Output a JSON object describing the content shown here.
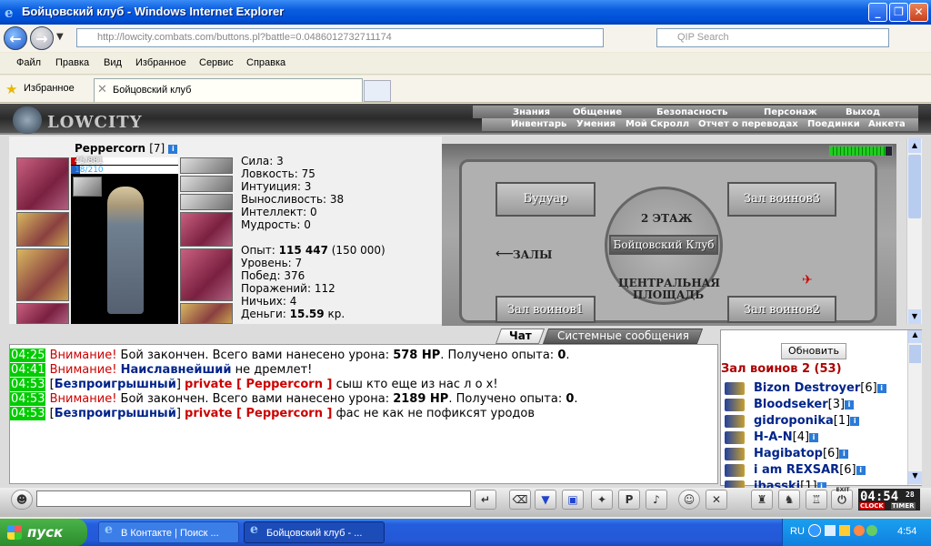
{
  "window": {
    "title": "Бойцовский клуб - Windows Internet Explorer"
  },
  "browser": {
    "url": "http://lowcity.combats.com/buttons.pl?battle=0.0486012732711174",
    "search_placeholder": "QIP Search",
    "menu": [
      "Файл",
      "Правка",
      "Вид",
      "Избранное",
      "Сервис",
      "Справка"
    ],
    "favorites_label": "Избранное",
    "tab_title": "Бойцовский клуб"
  },
  "game": {
    "logo": "LOWCITY",
    "menu_top": [
      "Знания",
      "Общение",
      "Безопасность",
      "Персонаж",
      "Выход"
    ],
    "menu_bottom": [
      "Инвентарь",
      "Умения",
      "Мой Скролл",
      "Отчет о переводах",
      "Поединки",
      "Анкета"
    ],
    "character": {
      "name": "Peppercorn",
      "level": "[7]",
      "hp": "45/881",
      "hp_fraction": 0.051,
      "mana": "18/210",
      "mana_fraction": 0.086
    },
    "stats": [
      {
        "label": "Сила:",
        "value": "3"
      },
      {
        "label": "Ловкость:",
        "value": "75"
      },
      {
        "label": "Интуиция:",
        "value": "3"
      },
      {
        "label": "Выносливость:",
        "value": "38"
      },
      {
        "label": "Интеллект:",
        "value": "0"
      },
      {
        "label": "Мудрость:",
        "value": "0"
      }
    ],
    "progress": [
      {
        "label": "Опыт:",
        "value": "115 447",
        "extra": "(150 000)"
      },
      {
        "label": "Уровень:",
        "value": "7"
      },
      {
        "label": "Побед:",
        "value": "376"
      },
      {
        "label": "Поражений:",
        "value": "112"
      },
      {
        "label": "Ничьих:",
        "value": "4"
      },
      {
        "label": "Деньги:",
        "value": "15.59",
        "extra": "кр."
      }
    ],
    "map": {
      "floor": "2 ЭТАЖ",
      "club": "Бойцовский Клуб",
      "boudoir": "Будуар",
      "hall3": "Зал воинов3",
      "halls": "ЗАЛЫ",
      "square": "ЦЕНТРАЛЬНАЯ ПЛОЩАДЬ",
      "hall1": "Зал воинов1",
      "hall2": "Зал воинов2"
    },
    "chat_tabs": [
      "Чат",
      "Системные сообщения"
    ],
    "chat": [
      {
        "time": "04:25",
        "parts": [
          {
            "t": "Внимание!",
            "c": "warn"
          },
          {
            "t": " Бой закончен. Всего вами нанесено урона: ",
            "c": ""
          },
          {
            "t": "578 HP",
            "c": "bold"
          },
          {
            "t": ". Получено опыта: ",
            "c": ""
          },
          {
            "t": "0",
            "c": "bold"
          },
          {
            "t": ".",
            "c": ""
          }
        ]
      },
      {
        "time": "04:41",
        "parts": [
          {
            "t": "Внимание!",
            "c": "warn"
          },
          {
            "t": " ",
            "c": ""
          },
          {
            "t": "Наиславнейший",
            "c": "blue"
          },
          {
            "t": " не дремлет!",
            "c": ""
          }
        ]
      },
      {
        "time": "04:53",
        "parts": [
          {
            "t": "[",
            "c": ""
          },
          {
            "t": "Безпроигрышный",
            "c": "blue"
          },
          {
            "t": "] ",
            "c": ""
          },
          {
            "t": "private [ Peppercorn ]",
            "c": "priv"
          },
          {
            "t": " сыш кто еще из нас л о х!",
            "c": ""
          }
        ]
      },
      {
        "time": "04:53",
        "parts": [
          {
            "t": "Внимание!",
            "c": "warn"
          },
          {
            "t": " Бой закончен. Всего вами нанесено урона: ",
            "c": ""
          },
          {
            "t": "2189 HP",
            "c": "bold"
          },
          {
            "t": ". Получено опыта: ",
            "c": ""
          },
          {
            "t": "0",
            "c": "bold"
          },
          {
            "t": ".",
            "c": ""
          }
        ]
      },
      {
        "time": "04:53",
        "parts": [
          {
            "t": "[",
            "c": ""
          },
          {
            "t": "Безпроигрышный",
            "c": "blue"
          },
          {
            "t": "] ",
            "c": ""
          },
          {
            "t": "private [ Peppercorn ]",
            "c": "priv"
          },
          {
            "t": " фас не как не пофиксят уродов",
            "c": ""
          }
        ]
      }
    ],
    "users": {
      "refresh": "Обновить",
      "room": "Зал воинов 2 (53)",
      "list": [
        {
          "name": "Bizon Destroyer",
          "level": "[6]"
        },
        {
          "name": "Bloodseker",
          "level": "[3]"
        },
        {
          "name": "gidroponika",
          "level": "[1]"
        },
        {
          "name": "H-A-N",
          "level": "[4]"
        },
        {
          "name": "Hagibatop",
          "level": "[6]"
        },
        {
          "name": "i am REXSAR",
          "level": "[6]"
        },
        {
          "name": "ibasski",
          "level": "[1]"
        }
      ]
    },
    "clock": {
      "time": "04:54",
      "seconds": "28",
      "clock_label": "CLOCK",
      "timer_label": "TIMER"
    },
    "exit_label": "EXIT"
  },
  "taskbar": {
    "start": "пуск",
    "tasks": [
      "В Контакте | Поиск ...",
      "Бойцовский клуб - ..."
    ],
    "lang": "RU",
    "time": "4:54"
  }
}
